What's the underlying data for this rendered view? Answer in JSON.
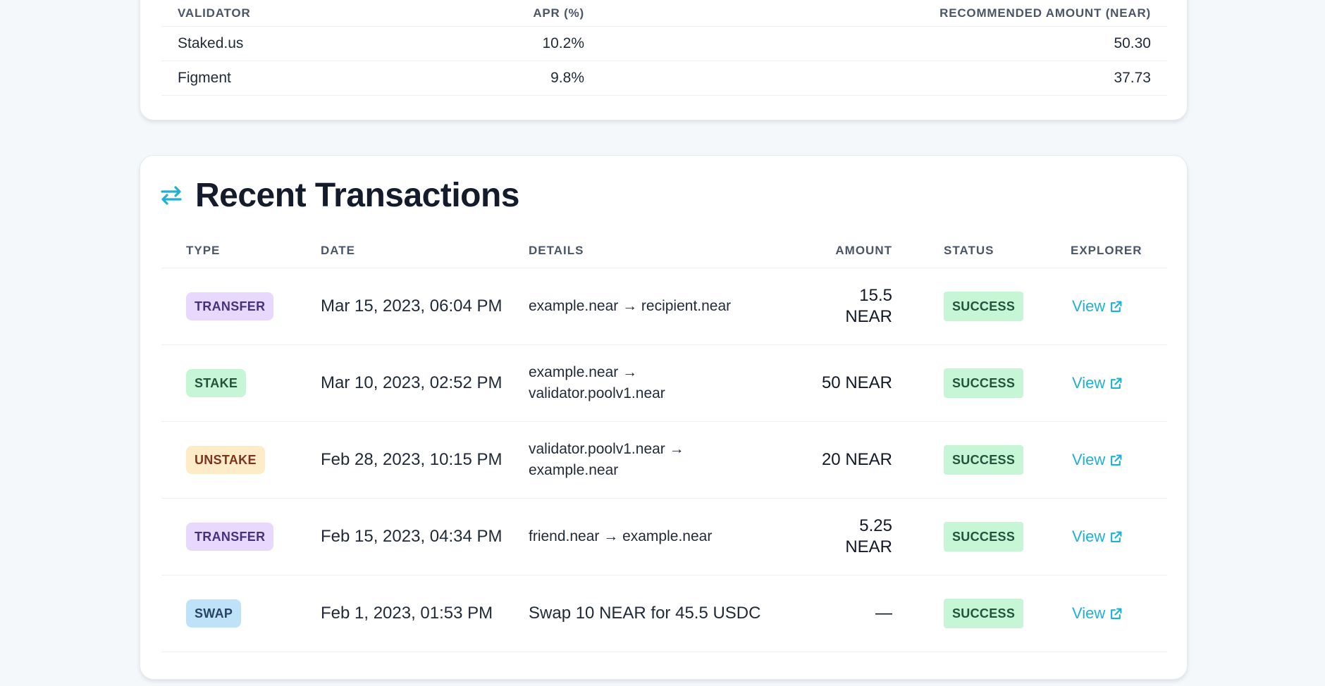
{
  "validators": {
    "headers": {
      "validator": "VALIDATOR",
      "apr": "APR (%)",
      "amount": "RECOMMENDED AMOUNT (NEAR)"
    },
    "rows": [
      {
        "name": "Staked.us",
        "apr": "10.2%",
        "amount": "50.30"
      },
      {
        "name": "Figment",
        "apr": "9.8%",
        "amount": "37.73"
      }
    ]
  },
  "transactions": {
    "title": "Recent Transactions",
    "title_icon": "arrows-exchange-icon",
    "headers": {
      "type": "TYPE",
      "date": "DATE",
      "details": "DETAILS",
      "amount": "AMOUNT",
      "status": "STATUS",
      "explorer": "EXPLORER"
    },
    "rows": [
      {
        "type": "TRANSFER",
        "date": "Mar 15, 2023, 06:04 PM",
        "details": "example.near → recipient.near",
        "amount": "15.5 NEAR",
        "status": "SUCCESS",
        "link": "View"
      },
      {
        "type": "STAKE",
        "date": "Mar 10, 2023, 02:52 PM",
        "details": "example.near → validator.poolv1.near",
        "amount": "50 NEAR",
        "status": "SUCCESS",
        "link": "View"
      },
      {
        "type": "UNSTAKE",
        "date": "Feb 28, 2023, 10:15 PM",
        "details": "validator.poolv1.near → example.near",
        "amount": "20 NEAR",
        "status": "SUCCESS",
        "link": "View"
      },
      {
        "type": "TRANSFER",
        "date": "Feb 15, 2023, 04:34 PM",
        "details": "friend.near → example.near",
        "amount": "5.25 NEAR",
        "status": "SUCCESS",
        "link": "View"
      },
      {
        "type": "SWAP",
        "date": "Feb 1, 2023, 01:53 PM",
        "details": "Swap 10 NEAR for 45.5 USDC",
        "amount": "—",
        "status": "SUCCESS",
        "link": "View"
      }
    ]
  },
  "colors": {
    "accent": "#1fb0d6",
    "transfer": "#e9d8fd",
    "stake": "#c6f6d5",
    "unstake": "#feebc8",
    "swap": "#bee3f8",
    "success": "#c6f6d5"
  },
  "icons": {
    "external_link": "external-link-icon"
  }
}
